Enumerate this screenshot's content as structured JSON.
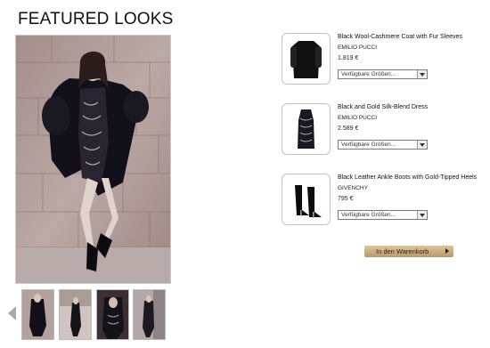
{
  "header": {
    "title": "FEATURED LOOKS"
  },
  "products": [
    {
      "name": "Black Wool-Cashmere Coat with Fur Sleeves",
      "brand": "EMILIO PUCCI",
      "price": "1.819 €",
      "size_select": "Verfügbare Größen..."
    },
    {
      "name": "Black and Gold Silk-Blend Dress",
      "brand": "EMILIO PUCCI",
      "price": "2.589 €",
      "size_select": "Verfügbare Größen..."
    },
    {
      "name": "Black Leather Ankle Boots with Gold-Tipped Heels",
      "brand": "GIVENCHY",
      "price": "795 €",
      "size_select": "Verfügbare Größen..."
    }
  ],
  "cart": {
    "label": "In den Warenkorb"
  },
  "colors": {
    "accent_button": "#c8ae82",
    "text": "#111111",
    "arrow": "#a9a9a9"
  },
  "icons": {
    "prev": "left-arrow-icon",
    "cart": "right-arrow-icon",
    "select": "dropdown-arrow-icon"
  }
}
